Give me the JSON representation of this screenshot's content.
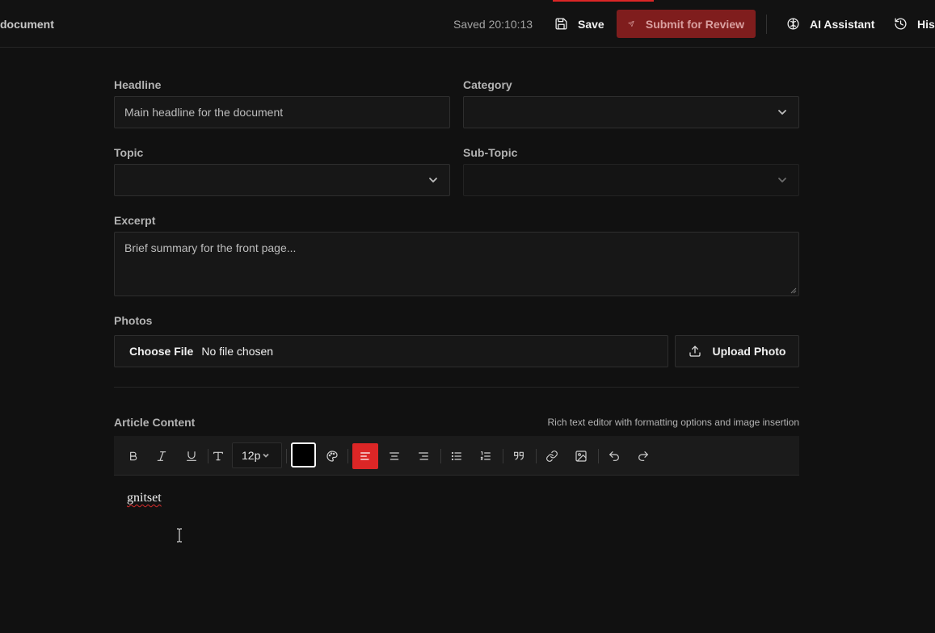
{
  "header": {
    "doc_title": "document",
    "saved_status": "Saved 20:10:13",
    "save_label": "Save",
    "submit_label": "Submit for Review",
    "ai_label": "AI Assistant",
    "history_label": "His",
    "icons": {
      "save": "floppy-disk-icon",
      "submit": "send-plane-icon",
      "ai": "brain-icon",
      "history": "history-clock-icon"
    }
  },
  "form": {
    "headline": {
      "label": "Headline",
      "value": "Main headline for the document"
    },
    "category": {
      "label": "Category",
      "value": ""
    },
    "topic": {
      "label": "Topic",
      "value": ""
    },
    "subtopic": {
      "label": "Sub-Topic",
      "value": "",
      "disabled": true
    },
    "excerpt": {
      "label": "Excerpt",
      "placeholder": "Brief summary for the front page..."
    },
    "photos": {
      "label": "Photos",
      "choose_label": "Choose File",
      "file_status": "No file chosen",
      "upload_label": "Upload Photo"
    }
  },
  "article": {
    "label": "Article Content",
    "hint": "Rich text editor with formatting options and image insertion",
    "toolbar": {
      "font_size": "12p",
      "text_color": "#000000",
      "active_alignment": "left",
      "buttons": [
        "bold",
        "italic",
        "underline",
        "text-style",
        "font-size",
        "text-color",
        "highlight-palette",
        "align-left",
        "align-center",
        "align-right",
        "bullet-list",
        "numbered-list",
        "blockquote",
        "link",
        "image",
        "undo",
        "redo"
      ]
    },
    "content": "gnitset"
  },
  "colors": {
    "accent": "#dc2626",
    "submit_bg": "#7f1d1d",
    "background": "#111111"
  }
}
